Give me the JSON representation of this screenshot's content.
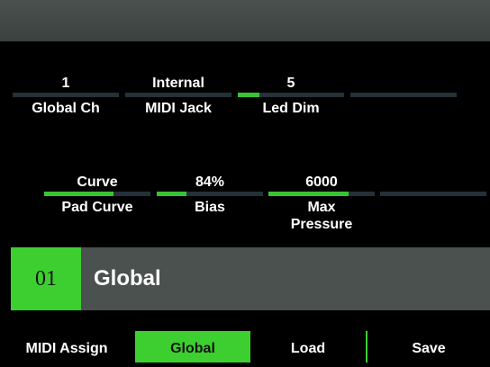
{
  "params_row1": [
    {
      "value": "1",
      "label": "Global Ch",
      "fill": 0
    },
    {
      "value": "Internal",
      "label": "MIDI Jack",
      "fill": 0
    },
    {
      "value": "5",
      "label": "Led Dim",
      "fill": 0.2
    },
    {
      "value": "",
      "label": "",
      "fill": 0
    }
  ],
  "params_row2": [
    {
      "value": "Curve",
      "label": "Pad Curve",
      "fill": 0.65
    },
    {
      "value": "84%",
      "label": "Bias",
      "fill": 0.28
    },
    {
      "value": "6000",
      "label": "Max Pressure",
      "fill": 0.75
    },
    {
      "value": "",
      "label": "",
      "fill": 0
    }
  ],
  "title": {
    "number": "01",
    "text": "Global"
  },
  "softkeys": [
    "MIDI Assign",
    "Global",
    "Load",
    "Save"
  ],
  "colors": {
    "accent": "#3dcf2f",
    "panel": "#4b514f",
    "track": "#253138"
  }
}
